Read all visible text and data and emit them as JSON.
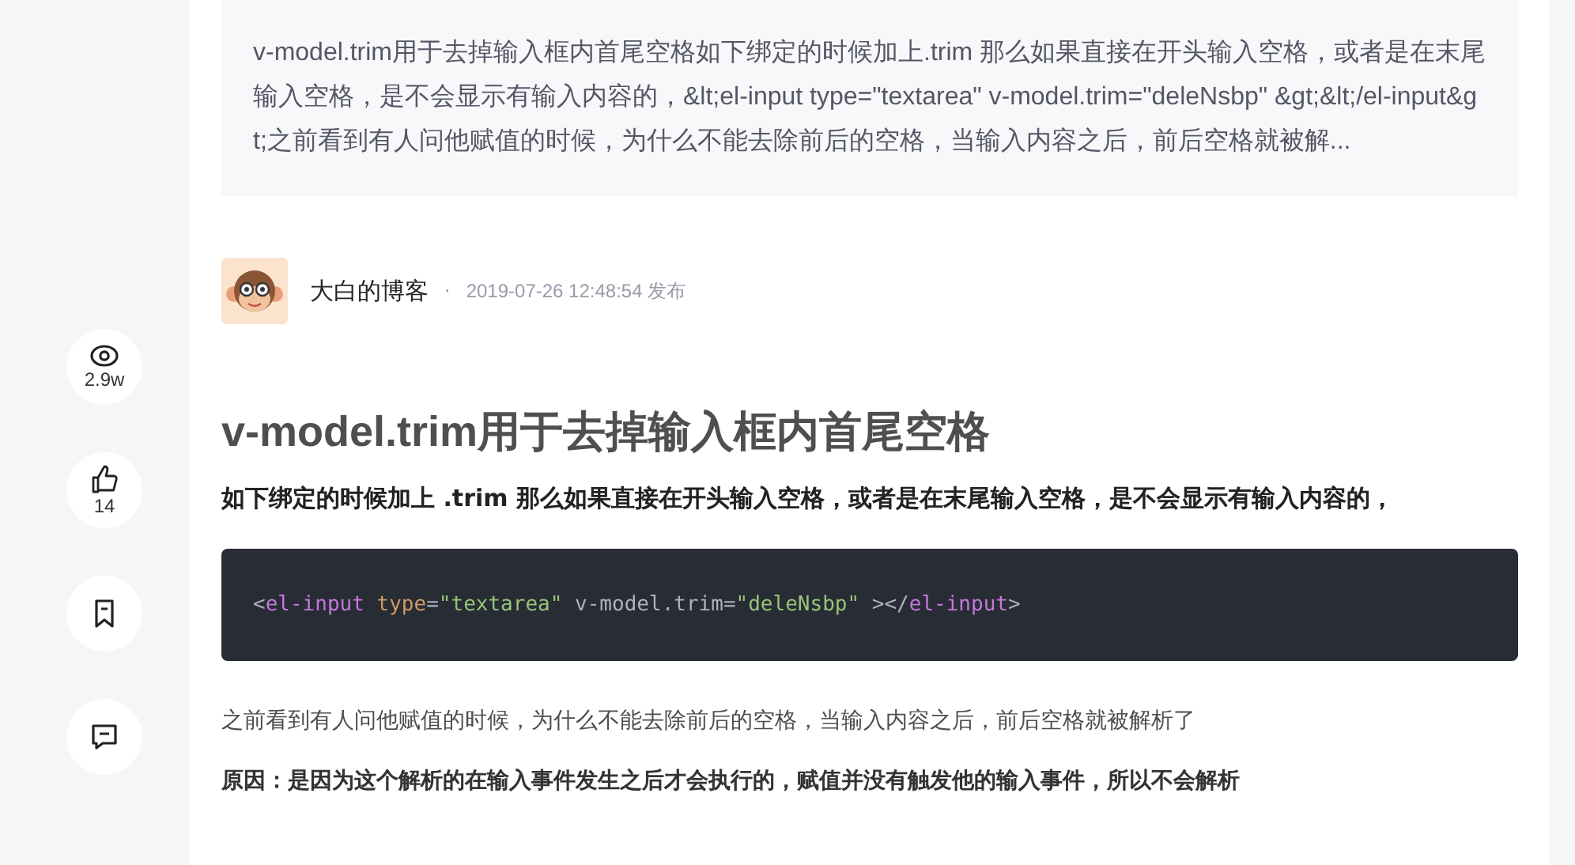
{
  "summary": "v-model.trim用于去掉输入框内首尾空格如下绑定的时候加上.trim 那么如果直接在开头输入空格，或者是在末尾输入空格，是不会显示有输入内容的，&lt;el-input type=\"textarea\" v-model.trim=\"deleNsbp\" &gt;&lt;/el-input&gt;之前看到有人问他赋值的时候，为什么不能去除前后的空格，当输入内容之后，前后空格就被解...",
  "actions": [
    {
      "kind": "views",
      "count": "2.9w"
    },
    {
      "kind": "like",
      "count": "14"
    },
    {
      "kind": "bookmark"
    },
    {
      "kind": "comment"
    }
  ],
  "author": {
    "name": "大白的博客",
    "separator": "·",
    "date": "2019-07-26 12:48:54 发布"
  },
  "title": "v-model.trim用于去掉输入框内首尾空格",
  "intro": "如下绑定的时候加上 .trim 那么如果直接在开头输入空格，或者是在末尾输入空格，是不会显示有输入内容的，",
  "code": [
    {
      "kind": "punct",
      "text": "<"
    },
    {
      "kind": "tag",
      "text": "el-input"
    },
    {
      "kind": "attr",
      "text": " type"
    },
    {
      "kind": "punct",
      "text": "="
    },
    {
      "kind": "string",
      "text": "\"textarea\""
    },
    {
      "kind": "plain",
      "text": " v-model.trim"
    },
    {
      "kind": "punct",
      "text": "="
    },
    {
      "kind": "string",
      "text": "\"deleNsbp\""
    },
    {
      "kind": "punct",
      "text": " ></"
    },
    {
      "kind": "tag",
      "text": "el-input"
    },
    {
      "kind": "punct",
      "text": ">"
    }
  ],
  "paragraph": "之前看到有人问他赋值的时候，为什么不能去除前后的空格，当输入内容之后，前后空格就被解析了",
  "reason": "原因：是因为这个解析的在输入事件发生之后才会执行的，赋值并没有触发他的输入事件，所以不会解析"
}
